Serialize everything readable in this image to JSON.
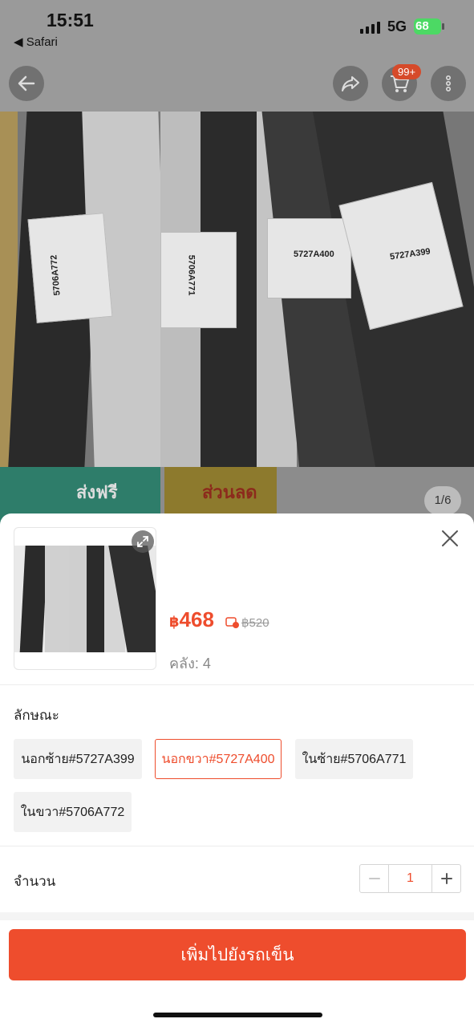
{
  "status_bar": {
    "time": "15:51",
    "back_app": "◀ Safari",
    "network": "5G",
    "battery": "68"
  },
  "product_page": {
    "cart_badge": "99+",
    "promo_free": "ส่งฟรี",
    "promo_sale": "ส่วนลด",
    "image_indicator": "1/6",
    "photo_labels": [
      "5706A772",
      "5706A771",
      "5727A400",
      "5727A399"
    ]
  },
  "sheet": {
    "currency": "฿",
    "price": "468",
    "old_price": "฿520",
    "stock_label": "คลัง: 4",
    "variant_section_title": "ลักษณะ",
    "variants": [
      {
        "label": "นอกซ้าย#5727A399",
        "selected": false
      },
      {
        "label": "นอกขวา#5727A400",
        "selected": true
      },
      {
        "label": "ในซ้าย#5706A771",
        "selected": false
      },
      {
        "label": "ในขวา#5706A772",
        "selected": false
      }
    ],
    "quantity_label": "จำนวน",
    "quantity_value": "1",
    "add_to_cart_label": "เพิ่มไปยังรถเข็น"
  },
  "colors": {
    "accent": "#ee4d2d",
    "stock_text": "#888888"
  }
}
